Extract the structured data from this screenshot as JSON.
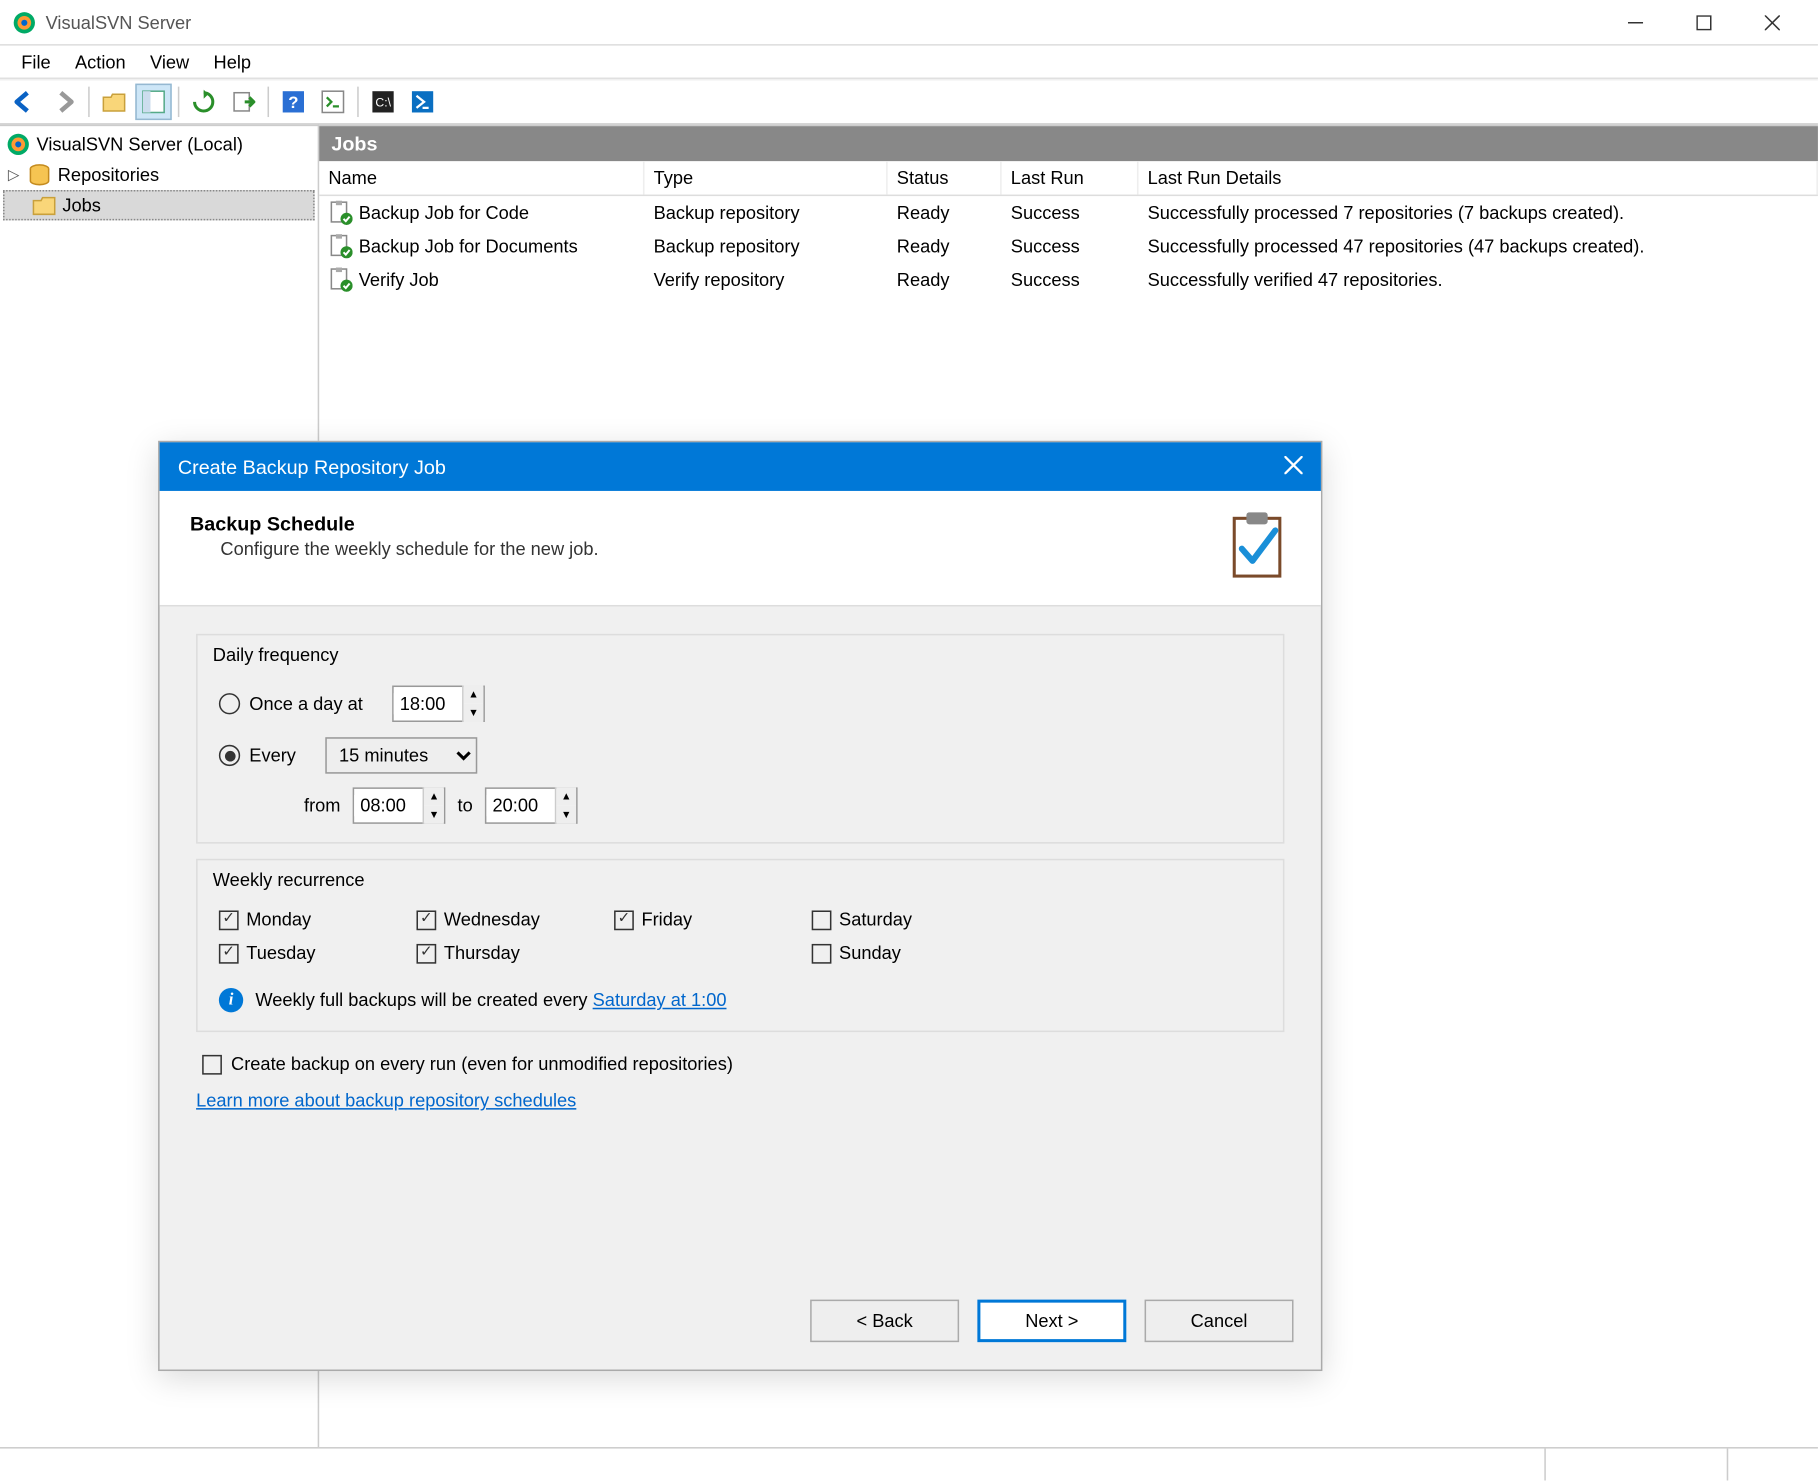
{
  "window": {
    "title": "VisualSVN Server"
  },
  "menu": {
    "items": [
      "File",
      "Action",
      "View",
      "Help"
    ]
  },
  "tree": {
    "root": "VisualSVN Server (Local)",
    "repositories": "Repositories",
    "jobs": "Jobs"
  },
  "list": {
    "heading": "Jobs",
    "columns": [
      "Name",
      "Type",
      "Status",
      "Last Run",
      "Last Run Details"
    ],
    "rows": [
      {
        "name": "Backup Job for Code",
        "type": "Backup repository",
        "status": "Ready",
        "lastrun": "Success",
        "details": "Successfully processed 7 repositories (7 backups created)."
      },
      {
        "name": "Backup Job for Documents",
        "type": "Backup repository",
        "status": "Ready",
        "lastrun": "Success",
        "details": "Successfully processed 47 repositories (47 backups created)."
      },
      {
        "name": "Verify Job",
        "type": "Verify repository",
        "status": "Ready",
        "lastrun": "Success",
        "details": "Successfully verified 47 repositories."
      }
    ]
  },
  "dialog": {
    "title": "Create Backup Repository Job",
    "heading": "Backup Schedule",
    "subheading": "Configure the weekly schedule for the new job.",
    "daily": {
      "group_label": "Daily frequency",
      "once_label": "Once a day at",
      "once_time": "18:00",
      "every_label": "Every",
      "every_value": "15 minutes",
      "from_label": "from",
      "from_time": "08:00",
      "to_label": "to",
      "to_time": "20:00"
    },
    "weekly": {
      "group_label": "Weekly recurrence",
      "days": [
        {
          "label": "Monday",
          "checked": true
        },
        {
          "label": "Wednesday",
          "checked": true
        },
        {
          "label": "Friday",
          "checked": true
        },
        {
          "label": "Saturday",
          "checked": false
        },
        {
          "label": "Tuesday",
          "checked": true
        },
        {
          "label": "Thursday",
          "checked": true
        },
        {
          "label": "",
          "checked": null
        },
        {
          "label": "Sunday",
          "checked": false
        }
      ],
      "info_prefix": "Weekly full backups will be created every ",
      "info_link": "Saturday at 1:00"
    },
    "every_run_label": "Create backup on every run (even for unmodified repositories)",
    "learn_more": "Learn more about backup repository schedules",
    "buttons": {
      "back": "< Back",
      "next": "Next >",
      "cancel": "Cancel"
    }
  }
}
